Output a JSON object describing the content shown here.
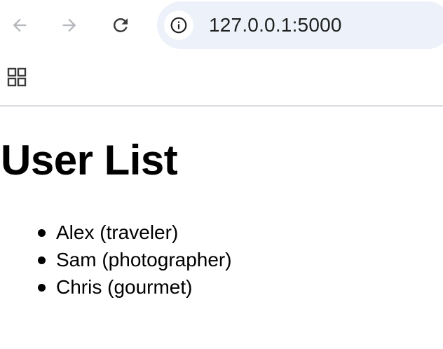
{
  "browser": {
    "url": "127.0.0.1:5000",
    "icons": {
      "back": "arrow-left-icon",
      "forward": "arrow-right-icon",
      "reload": "reload-icon",
      "site_info": "info-icon",
      "apps": "apps-grid-icon"
    }
  },
  "page": {
    "title": "User List",
    "users": [
      {
        "label": "Alex (traveler)"
      },
      {
        "label": "Sam (photographer)"
      },
      {
        "label": "Chris (gourmet)"
      }
    ]
  }
}
